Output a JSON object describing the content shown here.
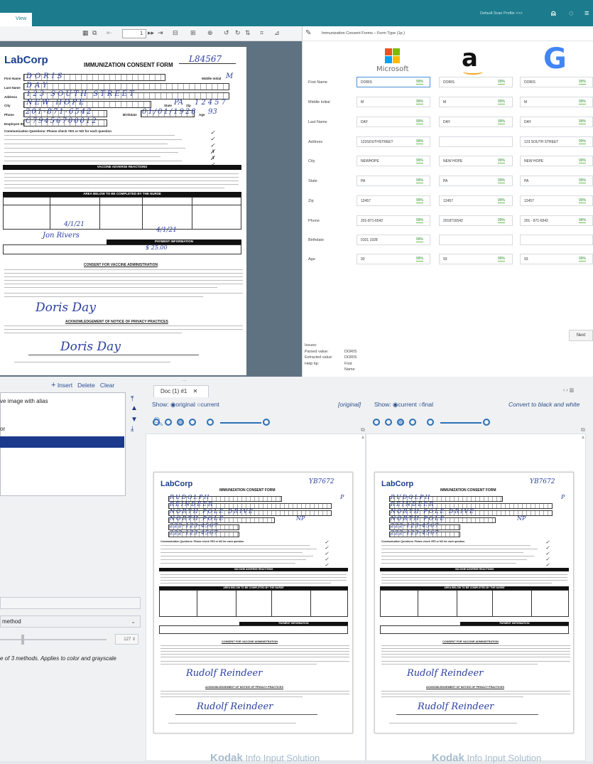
{
  "app": {
    "tabs": [
      "View"
    ],
    "profile_link": "Default Scan Profile >>>",
    "page_number": "1"
  },
  "form_panel": {
    "title": "Immunization Consent Forms – Form Type (1p.)",
    "providers": [
      "Microsoft",
      "Amazon",
      "Google"
    ],
    "rows": [
      {
        "label": "First Name",
        "values": [
          "DORIS",
          "DORIS",
          "DORIS"
        ],
        "conf": [
          "99%",
          "99%",
          "99%"
        ]
      },
      {
        "label": "Middle Initial",
        "values": [
          "M",
          "M",
          "M"
        ],
        "conf": [
          "99%",
          "99%",
          "99%"
        ]
      },
      {
        "label": "Last Name",
        "values": [
          "DAY",
          "DAY",
          "DAY"
        ],
        "conf": [
          "99%",
          "99%",
          "99%"
        ]
      },
      {
        "label": "Address",
        "values": [
          "123SOUTHSTREET",
          "",
          "123 SOUTH STREET"
        ],
        "conf": [
          "99%",
          "",
          "99%"
        ]
      },
      {
        "label": "City",
        "values": [
          "NEWHOPE",
          "NEW HOPE",
          "NEW HOPE"
        ],
        "conf": [
          "99%",
          "99%",
          "99%"
        ]
      },
      {
        "label": "State",
        "values": [
          "PA",
          "PA",
          "PA"
        ],
        "conf": [
          "99%",
          "99%",
          "99%"
        ]
      },
      {
        "label": "Zip",
        "values": [
          "12457",
          "12457",
          "12457"
        ],
        "conf": [
          "99%",
          "99%",
          "99%"
        ]
      },
      {
        "label": "Phone",
        "values": [
          "201-871-6542",
          "2018716542",
          "201 - 871-6542"
        ],
        "conf": [
          "99%",
          "99%",
          "94%"
        ]
      },
      {
        "label": "Birthdate",
        "values": [
          "0101 1928",
          "",
          ""
        ],
        "conf": [
          "99%",
          "",
          ""
        ]
      },
      {
        "label": "Age",
        "values": [
          "93",
          "93",
          "93"
        ],
        "conf": [
          "99%",
          "99%",
          "99%"
        ]
      }
    ],
    "issues_label": "Issues:",
    "parsed_label": "Parsed value:",
    "parsed_value": "DORIS",
    "extracted_label": "Extracted value:",
    "extracted_value": "DORIS",
    "help_label": "Help tip:",
    "help_value": "First Name",
    "next_label": "Next"
  },
  "left_panel": {
    "actions": {
      "insert": "Insert",
      "delete": "Delete",
      "clear": "Clear"
    },
    "list_items": [
      "ve image with alias",
      "or",
      ""
    ],
    "method_label": "method",
    "spin_value": "127",
    "description": "e of 3 methods. Applies to color and grayscale"
  },
  "viewer": {
    "doc_tab": "Doc (1) #1",
    "left": {
      "show_label": "Show:",
      "options": [
        "original",
        "current"
      ],
      "right_label": "[original]"
    },
    "right": {
      "show_label": "Show:",
      "options": [
        "current",
        "final"
      ],
      "right_label": "Convert to black and white"
    },
    "watermark_brand": "Kodak",
    "watermark_text": "Info Input Solution"
  },
  "doc_form": {
    "logo": "LabCorp",
    "title": "IMMUNIZATION CONSENT FORM",
    "labels": {
      "first": "First Name",
      "last": "Last Name",
      "address": "Address",
      "city": "City",
      "phone": "Phone",
      "employee": "Employee ID",
      "mi": "Middle Initial",
      "state": "State",
      "zip": "Zip",
      "birthdate": "Birthdate",
      "age": "Age"
    },
    "primary": {
      "number": "L84567",
      "first": "DORIS",
      "mi": "M",
      "last": "DAY",
      "address": "123 SOUTH STREET",
      "city": "NEW HOPE",
      "state": "PA",
      "zip": "12457",
      "phone": "201-871-6542",
      "birthdate": "01/01/1928",
      "age": "93",
      "employee": "C79456700012",
      "signature": "Doris Day"
    },
    "secondary": {
      "number": "YB7672",
      "first": "RUDOLPH",
      "mi": "P",
      "last": "REINDEER",
      "address": "NORTH POLE DRIVE",
      "city": "NORTH POLE",
      "state": "NP",
      "phone": "222-123-4567",
      "employee": "222-123-4567",
      "signature": "Rudolf Reindeer"
    },
    "sections": {
      "communication": "Communication Questions: Please check YES or NO for each question",
      "vaccine_reactions": "VACCINE ADVERSE REACTIONS",
      "nurse": "AREA BELOW TO BE COMPLETED BY THE NURSE",
      "payment": "PAYMENT INFORMATION",
      "consent": "CONSENT FOR VACCINE ADMINISTRATION",
      "privacy": "ACKNOWLEDGEMENT OF NOTICE OF PRIVACY PRACTICES"
    }
  },
  "colors": {
    "topbar": "#1c7c8d",
    "accent": "#2d4f8c",
    "selection": "#1c3a8c",
    "confidence": "#6cbf4d"
  }
}
